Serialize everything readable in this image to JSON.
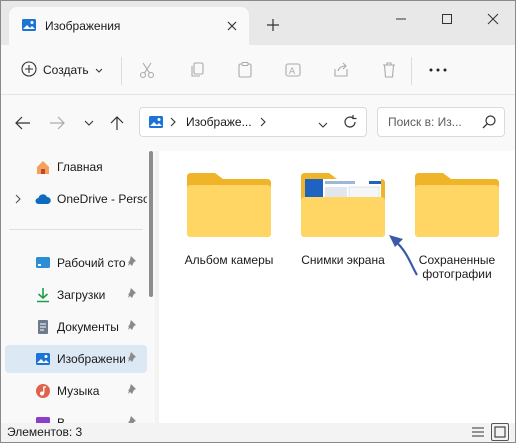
{
  "window": {
    "tab_title": "Изображения",
    "icons": {
      "tab": "pictures-icon",
      "close_tab": "close-icon",
      "new_tab": "plus-icon",
      "minimize": "minimize-icon",
      "maximize": "maximize-icon",
      "close": "close-icon"
    }
  },
  "toolbar": {
    "create_label": "Создать",
    "icons": [
      "cut-icon",
      "copy-icon",
      "paste-icon",
      "rename-icon",
      "share-icon",
      "delete-icon",
      "more-icon"
    ]
  },
  "navbar": {
    "address_path": "Изображе...",
    "search_placeholder": "Поиск в: Из..."
  },
  "sidebar": {
    "items": [
      {
        "label": "Главная",
        "icon": "home-icon"
      },
      {
        "label": "OneDrive - Perso",
        "icon": "cloud-icon"
      },
      {
        "label": "Рабочий сто",
        "icon": "desktop-icon",
        "pinned": true
      },
      {
        "label": "Загрузки",
        "icon": "download-icon",
        "pinned": true
      },
      {
        "label": "Документы",
        "icon": "document-icon",
        "pinned": true
      },
      {
        "label": "Изображени",
        "icon": "pictures-icon",
        "pinned": true,
        "selected": true
      },
      {
        "label": "Музыка",
        "icon": "music-icon",
        "pinned": true
      },
      {
        "label": "В",
        "icon": "video-icon",
        "pinned": true
      }
    ]
  },
  "main": {
    "folders": [
      {
        "label": "Альбом камеры"
      },
      {
        "label": "Снимки экрана"
      },
      {
        "label": "Сохраненные фотографии"
      }
    ]
  },
  "statusbar": {
    "item_count": "Элементов: 3"
  },
  "colors": {
    "accent": "#005fb8",
    "folder_back": "#f0b429",
    "folder_front": "#ffd664",
    "annotation_arrow": "#3a5aa8",
    "selected_bg": "#dde8f5"
  }
}
